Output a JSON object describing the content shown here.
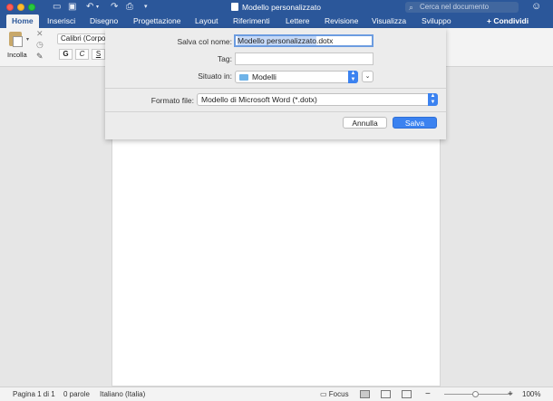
{
  "window": {
    "title": "Modello personalizzato",
    "search_placeholder": "Cerca nel documento"
  },
  "ribbon_tabs": [
    "Home",
    "Inserisci",
    "Disegno",
    "Progettazione",
    "Layout",
    "Riferimenti",
    "Lettere",
    "Revisione",
    "Visualizza",
    "Sviluppo"
  ],
  "share_label": "Condividi",
  "ribbon": {
    "paste_label": "Incolla",
    "font_name": "Calibri (Corpo)",
    "bold": "G",
    "italic": "C",
    "underline": "S"
  },
  "save_dialog": {
    "save_as_label": "Salva col nome:",
    "filename_selected": "Modello personalizzato",
    "filename_ext": ".dotx",
    "tags_label": "Tag:",
    "tags_value": "",
    "location_label": "Situato in:",
    "location_value": "Modelli",
    "format_label": "Formato file:",
    "format_value": "Modello di Microsoft Word (*.dotx)",
    "cancel_label": "Annulla",
    "save_label": "Salva"
  },
  "statusbar": {
    "page": "Pagina 1 di 1",
    "words": "0 parole",
    "language": "Italiano (Italia)",
    "focus": "Focus",
    "zoom": "100%"
  },
  "colors": {
    "brand": "#2b579a",
    "accent": "#3b82f0"
  },
  "icons": [
    "sidebar-toggle-icon",
    "save-icon",
    "undo-icon",
    "redo-icon",
    "print-icon",
    "search-icon",
    "share-icon",
    "smiley-icon",
    "paste-icon",
    "cut-icon",
    "copy-icon",
    "format-painter-icon",
    "folder-icon"
  ]
}
